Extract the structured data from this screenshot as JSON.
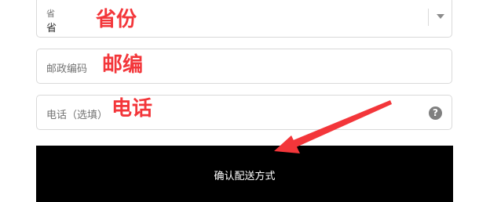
{
  "province_field": {
    "label": "省",
    "value": "省"
  },
  "postal_field": {
    "placeholder": "邮政编码"
  },
  "phone_field": {
    "placeholder": "电话（选填）",
    "help_icon": "?"
  },
  "annotations": {
    "province": "省份",
    "postal": "邮编",
    "phone": "电话"
  },
  "submit_button": {
    "label": "确认配送方式"
  },
  "colors": {
    "annotation": "#f3363a",
    "button_bg": "#000000"
  }
}
